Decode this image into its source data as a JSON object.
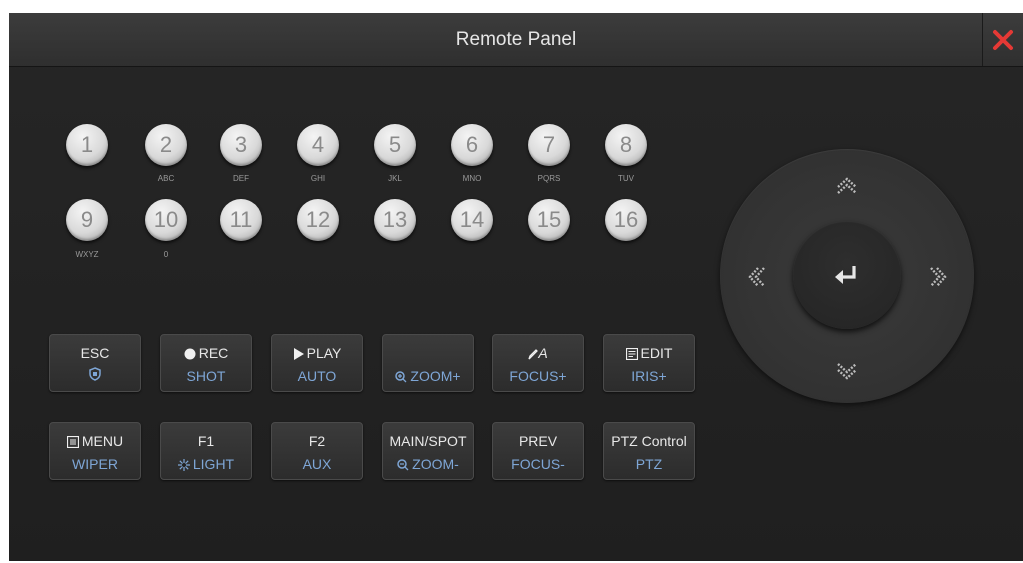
{
  "window": {
    "title": "Remote Panel"
  },
  "number_keys": [
    {
      "label": "1",
      "sub": ""
    },
    {
      "label": "2",
      "sub": "ABC"
    },
    {
      "label": "3",
      "sub": "DEF"
    },
    {
      "label": "4",
      "sub": "GHI"
    },
    {
      "label": "5",
      "sub": "JKL"
    },
    {
      "label": "6",
      "sub": "MNO"
    },
    {
      "label": "7",
      "sub": "PQRS"
    },
    {
      "label": "8",
      "sub": "TUV"
    },
    {
      "label": "9",
      "sub": "WXYZ"
    },
    {
      "label": "10",
      "sub": "0"
    },
    {
      "label": "11",
      "sub": ""
    },
    {
      "label": "12",
      "sub": ""
    },
    {
      "label": "13",
      "sub": ""
    },
    {
      "label": "14",
      "sub": ""
    },
    {
      "label": "15",
      "sub": ""
    },
    {
      "label": "16",
      "sub": ""
    }
  ],
  "function_keys": {
    "esc": {
      "top": "ESC",
      "bottom": ""
    },
    "rec": {
      "top": "REC",
      "bottom": "SHOT"
    },
    "play": {
      "top": "PLAY",
      "bottom": "AUTO"
    },
    "zoom_in": {
      "top": "",
      "bottom": "ZOOM+"
    },
    "focus_in": {
      "top": "A",
      "bottom": "FOCUS+"
    },
    "edit": {
      "top": "EDIT",
      "bottom": "IRIS+"
    },
    "menu": {
      "top": "MENU",
      "bottom": "WIPER"
    },
    "f1": {
      "top": "F1",
      "bottom": "LIGHT"
    },
    "f2": {
      "top": "F2",
      "bottom": "AUX"
    },
    "main_spot": {
      "top": "MAIN/SPOT",
      "bottom": "ZOOM-"
    },
    "prev": {
      "top": "PREV",
      "bottom": "FOCUS-"
    },
    "ptz_control": {
      "top": "PTZ Control",
      "bottom": "PTZ"
    }
  },
  "colors": {
    "accent_text": "#7ea6d6",
    "close_x": "#e53935",
    "background": "#222222"
  },
  "icons": [
    "close-icon",
    "shield-icon",
    "record-dot-icon",
    "play-triangle-icon",
    "zoom-in-icon",
    "focus-pen-icon",
    "edit-icon",
    "menu-icon",
    "light-icon",
    "zoom-out-icon",
    "arrow-up-icon",
    "arrow-down-icon",
    "arrow-left-icon",
    "arrow-right-icon",
    "enter-icon"
  ]
}
